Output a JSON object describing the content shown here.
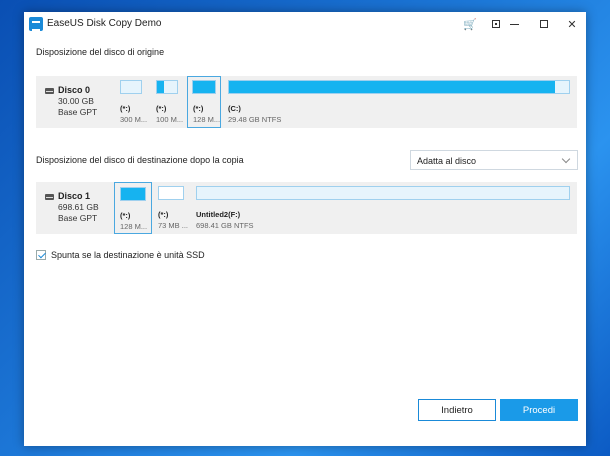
{
  "window": {
    "title": "EaseUS Disk Copy Demo",
    "accent": "#1a8ad8"
  },
  "titlebar_icons": [
    "cart-icon",
    "restore-small-icon",
    "minimize-icon",
    "maximize-icon",
    "close-icon"
  ],
  "titlebar_glyphs": {
    "close": "✕"
  },
  "source": {
    "heading": "Disposizione del disco di origine",
    "disk": {
      "name": "Disco 0",
      "size": "30.00 GB",
      "type": "Base GPT"
    },
    "partitions": [
      {
        "letter": "(*:)",
        "info": "300 M...",
        "fill": 0.0,
        "selected": false
      },
      {
        "letter": "(*:)",
        "info": "100 M...",
        "fill": 0.35,
        "selected": false
      },
      {
        "letter": "(*:)",
        "info": "128 M...",
        "fill": 1.0,
        "selected": true
      },
      {
        "letter": "(C:)",
        "info": "29.48 GB NTFS",
        "fill": 0.96,
        "selected": false
      }
    ]
  },
  "destination": {
    "heading": "Disposizione del disco di destinazione dopo la copia",
    "dropdown_value": "Adatta al disco",
    "disk": {
      "name": "Disco 1",
      "size": "698.61 GB",
      "type": "Base GPT"
    },
    "partitions": [
      {
        "letter": "(*:)",
        "info": "128 M...",
        "fill": 1.0,
        "selected": true
      },
      {
        "letter": "(*:)",
        "info": "73 MB ...",
        "fill": 0.0,
        "selected": false
      },
      {
        "letter": "Untitled2(F:)",
        "info": "698.41 GB NTFS",
        "fill": 0.0,
        "selected": false
      }
    ]
  },
  "ssd_checkbox": {
    "label": "Spunta se la destinazione è unità SSD",
    "checked": true
  },
  "buttons": {
    "back": "Indietro",
    "next": "Procedi"
  }
}
